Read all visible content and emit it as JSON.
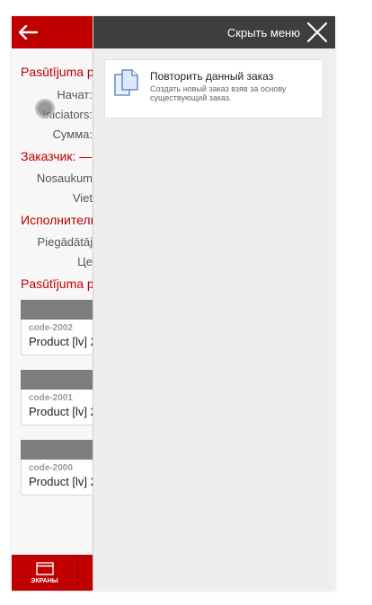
{
  "topbar": {
    "back_icon": "arrow-left-icon"
  },
  "order": {
    "section_order_title": "Pasūtījuma p",
    "rows": [
      {
        "label": "Начат:"
      },
      {
        "label": "Iniciators:"
      },
      {
        "label": "Сумма:"
      }
    ],
    "section_customer_title": "Заказчик: —",
    "customer_rows": [
      {
        "label": "Nosaukum"
      },
      {
        "label": "Viet"
      }
    ],
    "section_executor_title": "Исполнитель",
    "executor_rows": [
      {
        "label": "Piegādātāj"
      },
      {
        "label": "Це"
      }
    ],
    "section_positions_title": "Pasūtījuma p"
  },
  "products": [
    {
      "code": "code-2002",
      "name": "Product [lv] 2"
    },
    {
      "code": "code-2001",
      "name": "Product [lv] 2"
    },
    {
      "code": "code-2000",
      "name": "Product [lv] 2"
    }
  ],
  "bottombar": {
    "screens_label": "ЭКРАНЫ",
    "screens_icon": "window-icon"
  },
  "panel": {
    "hide_menu_label": "Скрыть меню",
    "close_icon": "close-icon",
    "items": [
      {
        "title": "Повторить данный заказ",
        "description": "Создать новый заказ взяв за основу существующий заказ.",
        "icon": "documents-icon"
      }
    ]
  },
  "colors": {
    "accent": "#c00000",
    "panel_header": "#3e3e3e",
    "panel_bg": "#eeeeee"
  }
}
